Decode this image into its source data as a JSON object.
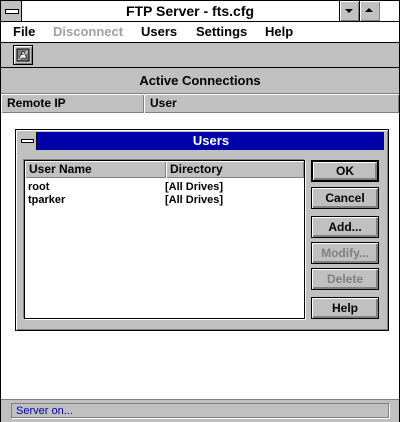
{
  "window": {
    "title": "FTP Server - fts.cfg"
  },
  "menu": {
    "items": [
      {
        "label": "File",
        "enabled": true
      },
      {
        "label": "Disconnect",
        "enabled": false
      },
      {
        "label": "Users",
        "enabled": true
      },
      {
        "label": "Settings",
        "enabled": true
      },
      {
        "label": "Help",
        "enabled": true
      }
    ]
  },
  "toolbar": {
    "buttons": [
      {
        "icon": "users-tool-icon"
      }
    ]
  },
  "connections": {
    "header": "Active Connections",
    "columns": [
      "Remote IP",
      "User"
    ]
  },
  "users_dialog": {
    "title": "Users",
    "columns": [
      "User Name",
      "Directory"
    ],
    "rows": [
      {
        "user": "root",
        "directory": "[All Drives]"
      },
      {
        "user": "tparker",
        "directory": "[All Drives]"
      }
    ],
    "buttons": {
      "ok": "OK",
      "cancel": "Cancel",
      "add": "Add...",
      "modify": "Modify...",
      "delete": "Delete",
      "help": "Help"
    },
    "disabled_buttons": [
      "modify",
      "delete"
    ]
  },
  "status": {
    "text": "Server on..."
  },
  "colors": {
    "face": "#c0c0c0",
    "dialog_title": "#0000a8",
    "status_text": "#0000a8",
    "disabled_text": "#a0a0a0"
  }
}
